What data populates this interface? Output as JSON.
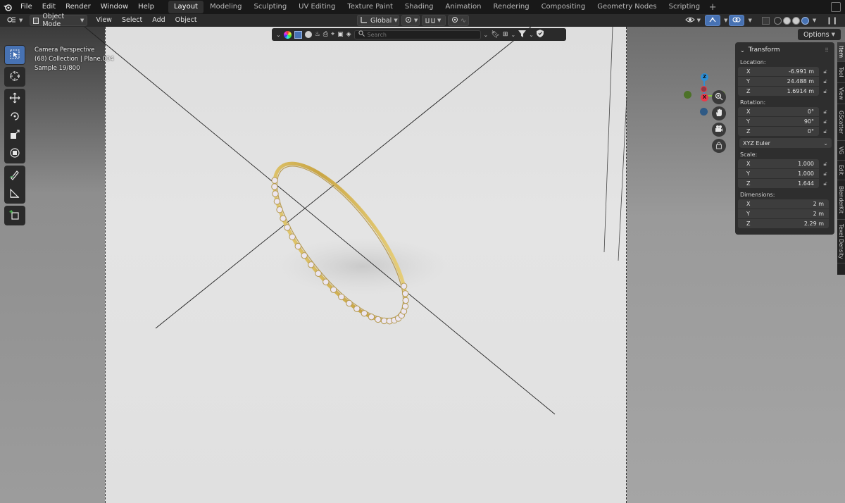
{
  "topbar": {
    "menus": [
      "File",
      "Edit",
      "Render",
      "Window",
      "Help"
    ],
    "workspaces": [
      "Layout",
      "Modeling",
      "Sculpting",
      "UV Editing",
      "Texture Paint",
      "Shading",
      "Animation",
      "Rendering",
      "Compositing",
      "Geometry Nodes",
      "Scripting"
    ],
    "active_workspace": "Layout",
    "add_workspace": "+"
  },
  "header": {
    "mode": "Object Mode",
    "menus": [
      "View",
      "Select",
      "Add",
      "Object"
    ],
    "orientation": "Global",
    "search_placeholder": "Search",
    "options_label": "Options"
  },
  "viewport": {
    "overlay_line1": "Camera Perspective",
    "overlay_line2": "(68) Collection | Plane.004",
    "overlay_line3": "Sample 19/800"
  },
  "gizmo": {
    "x": "X",
    "y": "Y",
    "z": "Z",
    "colors": {
      "x": "#e8394b",
      "y": "#86c43a",
      "z": "#2e8fd6",
      "neg_x": "#8f3a44",
      "neg_y": "#4d7228",
      "neg_z": "#2f5a85"
    }
  },
  "npanel": {
    "title": "Transform",
    "location_label": "Location:",
    "location": {
      "x": "-6.991 m",
      "y": "24.488 m",
      "z": "1.6914 m"
    },
    "rotation_label": "Rotation:",
    "rotation": {
      "x": "0°",
      "y": "90°",
      "z": "0°"
    },
    "rotation_mode": "XYZ Euler",
    "scale_label": "Scale:",
    "scale": {
      "x": "1.000",
      "y": "1.000",
      "z": "1.644"
    },
    "dimensions_label": "Dimensions:",
    "dimensions": {
      "x": "2 m",
      "y": "2 m",
      "z": "2.29 m"
    },
    "axis_x": "X",
    "axis_y": "Y",
    "axis_z": "Z"
  },
  "sidetabs": [
    "Item",
    "Tool",
    "View",
    "GScatter",
    "VG",
    "Edit",
    "BlenderKit",
    "Texel Density"
  ],
  "colors": {
    "accent": "#4772b3",
    "ring_gold": "#d4b45a",
    "panel_bg": "#2e2e2e"
  }
}
